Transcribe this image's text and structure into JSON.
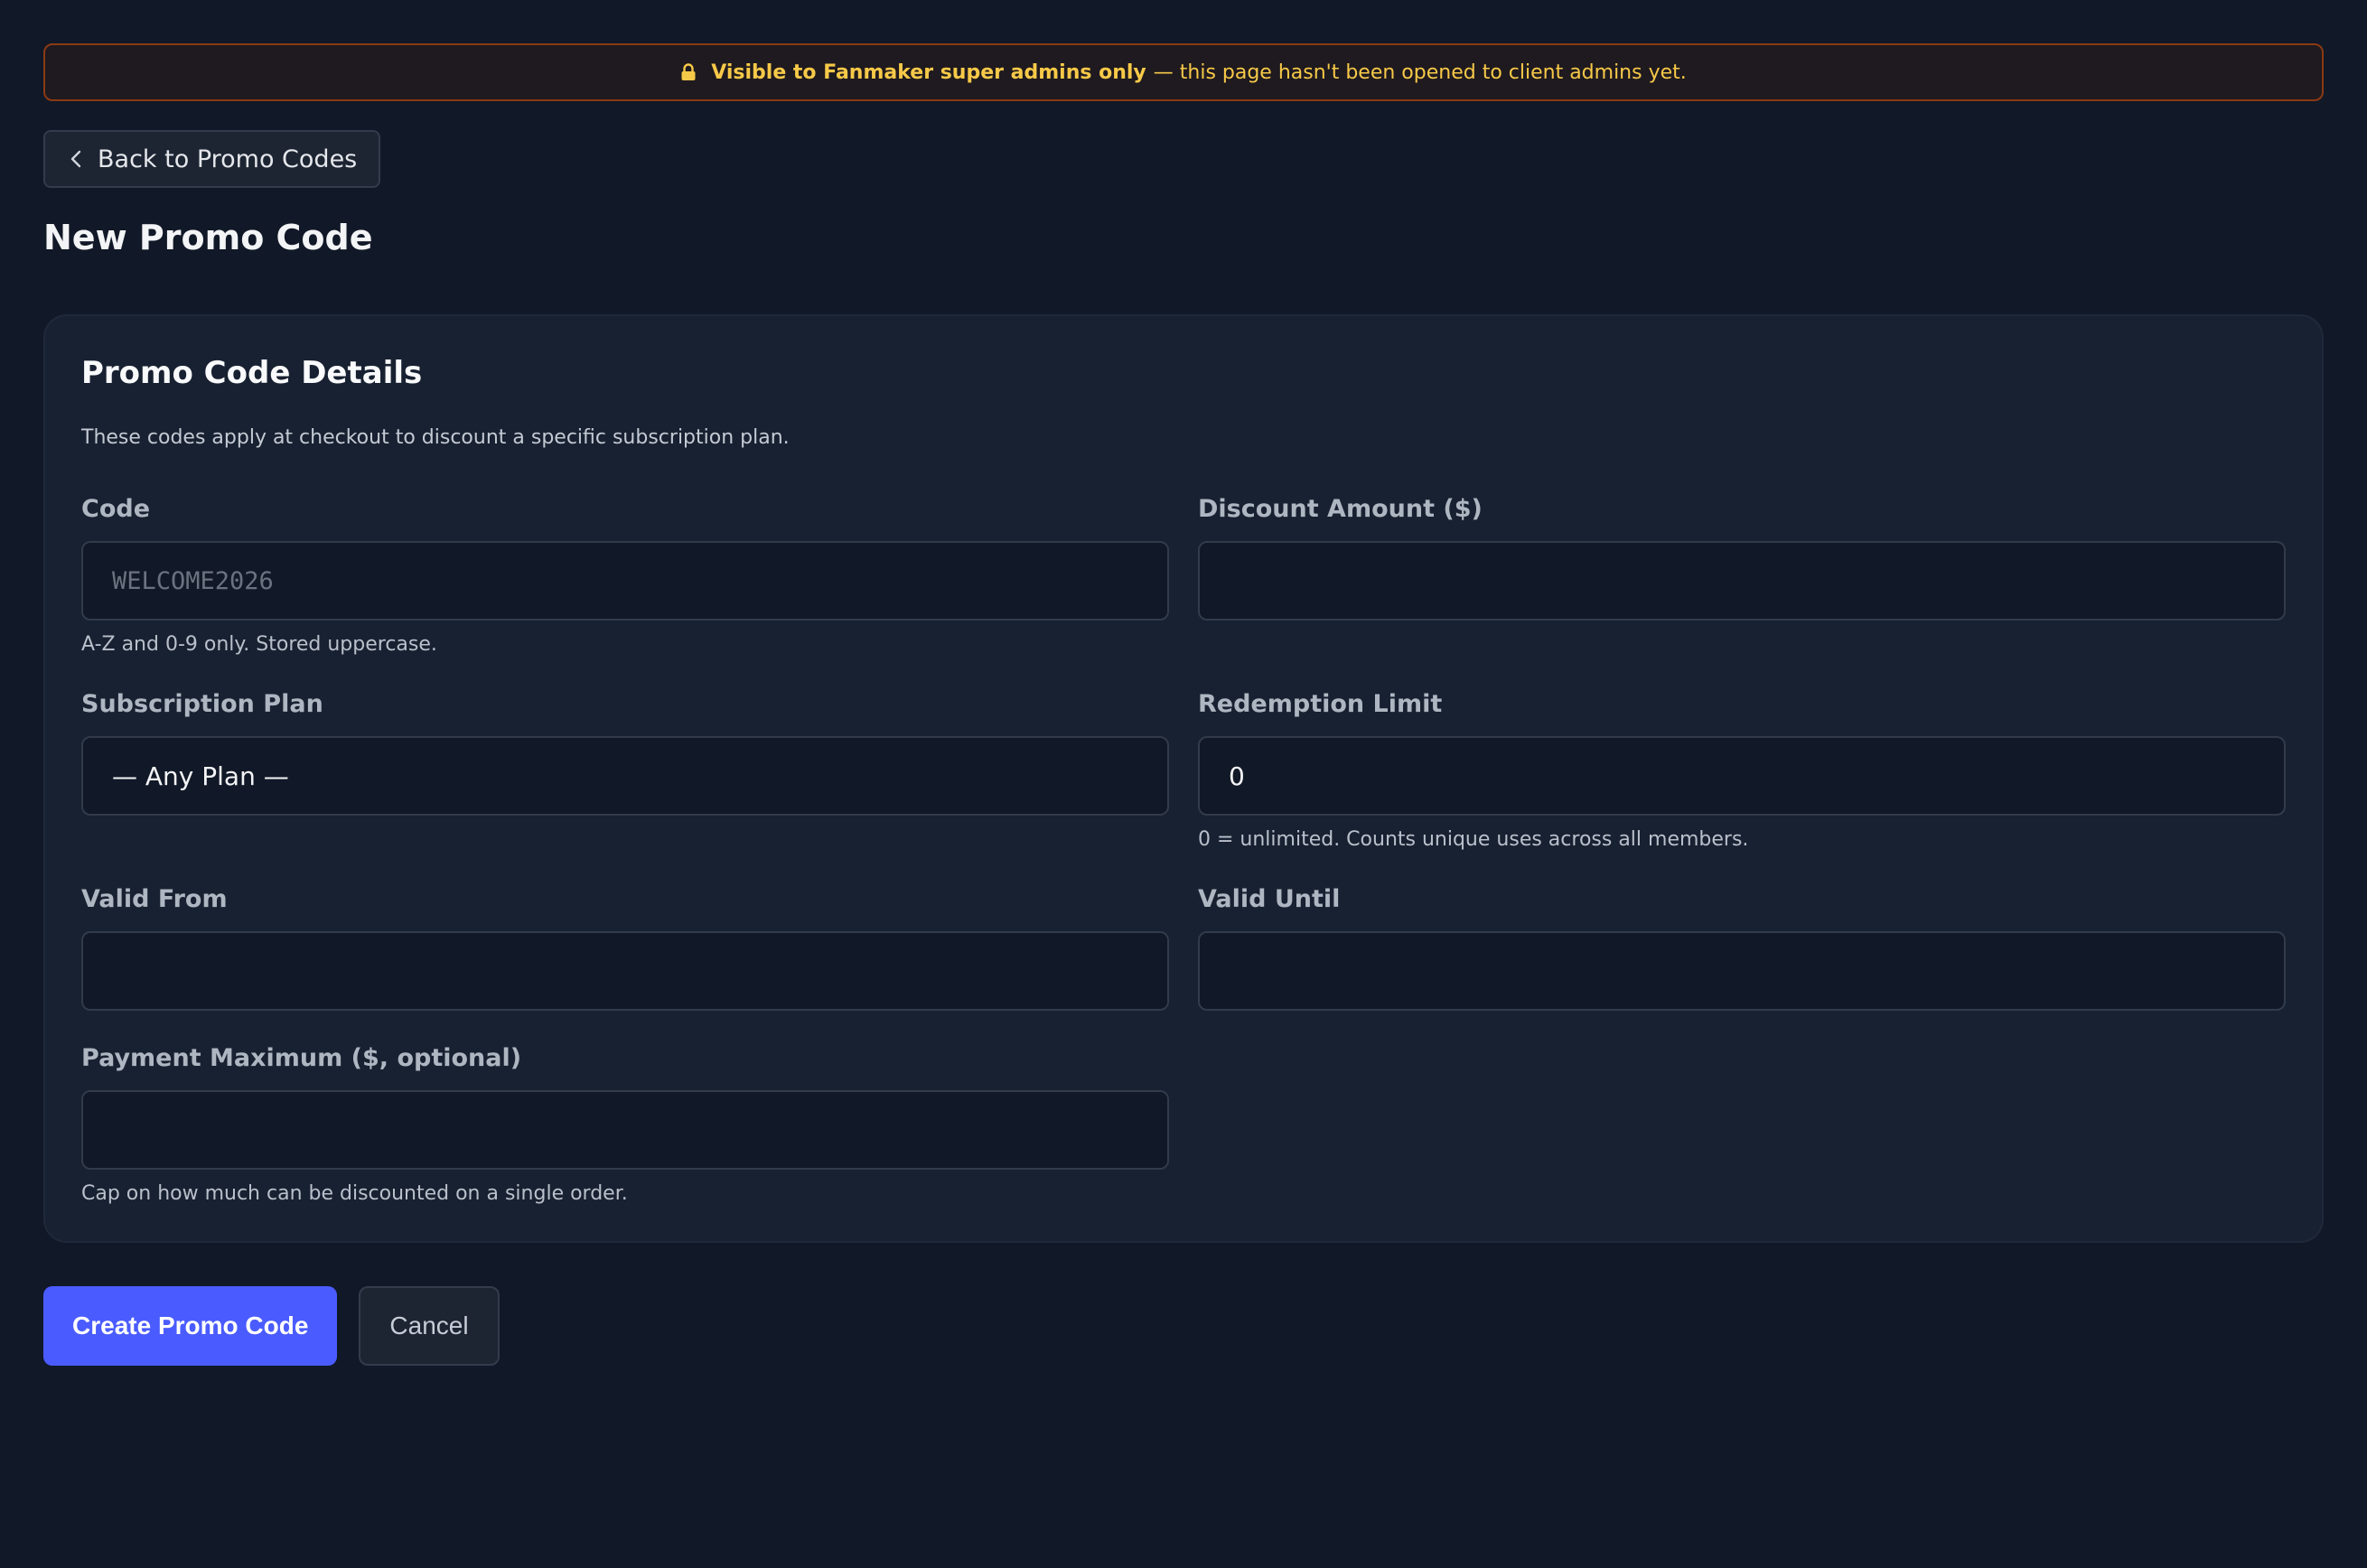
{
  "banner": {
    "icon": "lock-icon",
    "strong": "Visible to Fanmaker super admins only",
    "rest": "— this page hasn't been opened to client admins yet.",
    "color": "#f7c948",
    "border_color": "#8a3a14"
  },
  "back_button": {
    "icon": "chevron-left-icon",
    "label": "Back to Promo Codes"
  },
  "page_title": "New Promo Code",
  "card": {
    "title": "Promo Code Details",
    "description": "These codes apply at checkout to discount a specific subscription plan."
  },
  "fields": {
    "code": {
      "label": "Code",
      "value": "",
      "placeholder": "WELCOME2026",
      "hint": "A-Z and 0-9 only. Stored uppercase."
    },
    "discount_amount": {
      "label": "Discount Amount ($)",
      "value": ""
    },
    "subscription_plan": {
      "label": "Subscription Plan",
      "value": "— Any Plan —"
    },
    "redemption_limit": {
      "label": "Redemption Limit",
      "value": "0",
      "hint": "0 = unlimited. Counts unique uses across all members."
    },
    "valid_from": {
      "label": "Valid From",
      "value": ""
    },
    "valid_until": {
      "label": "Valid Until",
      "value": ""
    },
    "payment_maximum": {
      "label": "Payment Maximum ($, optional)",
      "value": "",
      "hint": "Cap on how much can be discounted on a single order."
    }
  },
  "actions": {
    "create_label": "Create Promo Code",
    "cancel_label": "Cancel",
    "primary_color": "#4a5cff"
  }
}
